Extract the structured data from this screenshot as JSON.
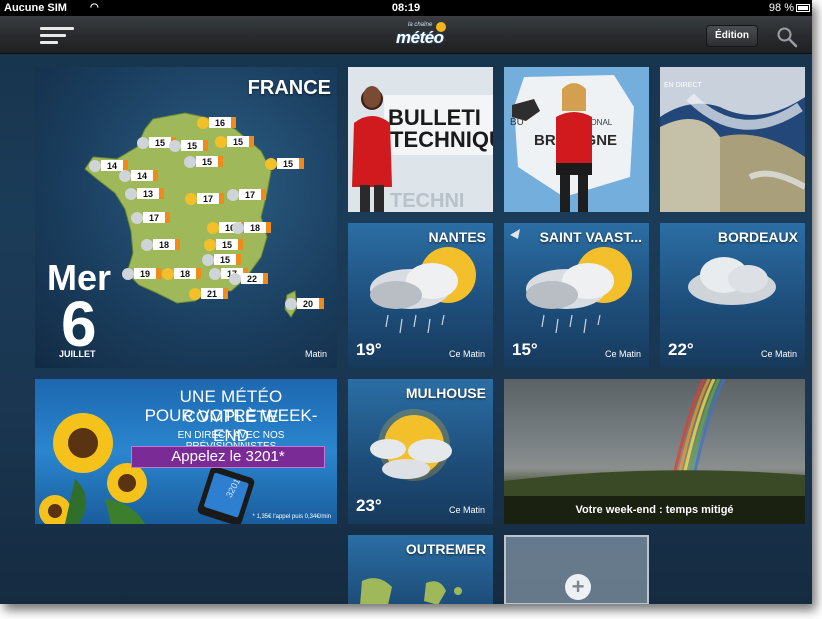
{
  "status_bar": {
    "carrier": "Aucune SIM",
    "time": "08:19",
    "battery": "98 %"
  },
  "nav": {
    "logo_small": "la chaîne",
    "logo_big": "météo",
    "edit_label": "Édition",
    "menu_icon": "menu-icon",
    "search_icon": "search-icon"
  },
  "france": {
    "title": "FRANCE",
    "day": "Mer",
    "day_number": "6",
    "month": "JUILLET",
    "period": "Matin",
    "temperatures": [
      "16",
      "15",
      "15",
      "15",
      "15",
      "14",
      "15",
      "14",
      "13",
      "17",
      "17",
      "17",
      "16",
      "18",
      "18",
      "15",
      "15",
      "19",
      "18",
      "17",
      "22",
      "21",
      "20"
    ]
  },
  "videos": [
    {
      "text": "BULLETIN TECHNIQUE"
    },
    {
      "text": "BULLETIN RÉGIONAL BRETAGNE"
    },
    {
      "text": "EN DIRECT AUJOURD'HUI"
    }
  ],
  "cities": [
    {
      "name": "NANTES",
      "temp": "19°",
      "when": "Ce Matin",
      "icon": "cloud-sun-rain-icon"
    },
    {
      "name": "SAINT VAAST...",
      "temp": "15°",
      "when": "Ce Matin",
      "icon": "cloud-sun-rain-icon"
    },
    {
      "name": "BORDEAUX",
      "temp": "22°",
      "when": "Ce Matin",
      "icon": "cloud-icon"
    },
    {
      "name": "MULHOUSE",
      "temp": "23°",
      "when": "Ce Matin",
      "icon": "sun-cloud-icon"
    }
  ],
  "ad": {
    "line1": "UNE MÉTÉO COMPLÈTE",
    "line2": "POUR VOTRE WEEK-END",
    "line3": "EN DIRECT AVEC NOS PRÉVISIONNISTES",
    "cta": "Appelez le 3201*",
    "phone_number": "3201",
    "legal": "* 1,35€ l'appel puis 0,34€/min"
  },
  "weekend": {
    "caption": "Votre week-end : temps mitigé"
  },
  "outremer": {
    "title": "OUTREMER"
  },
  "add_tile": {
    "symbol": "+"
  },
  "colors": {
    "accent": "#f4b51c",
    "navbar": "#2a2c2f",
    "cta": "#7b2b95"
  }
}
